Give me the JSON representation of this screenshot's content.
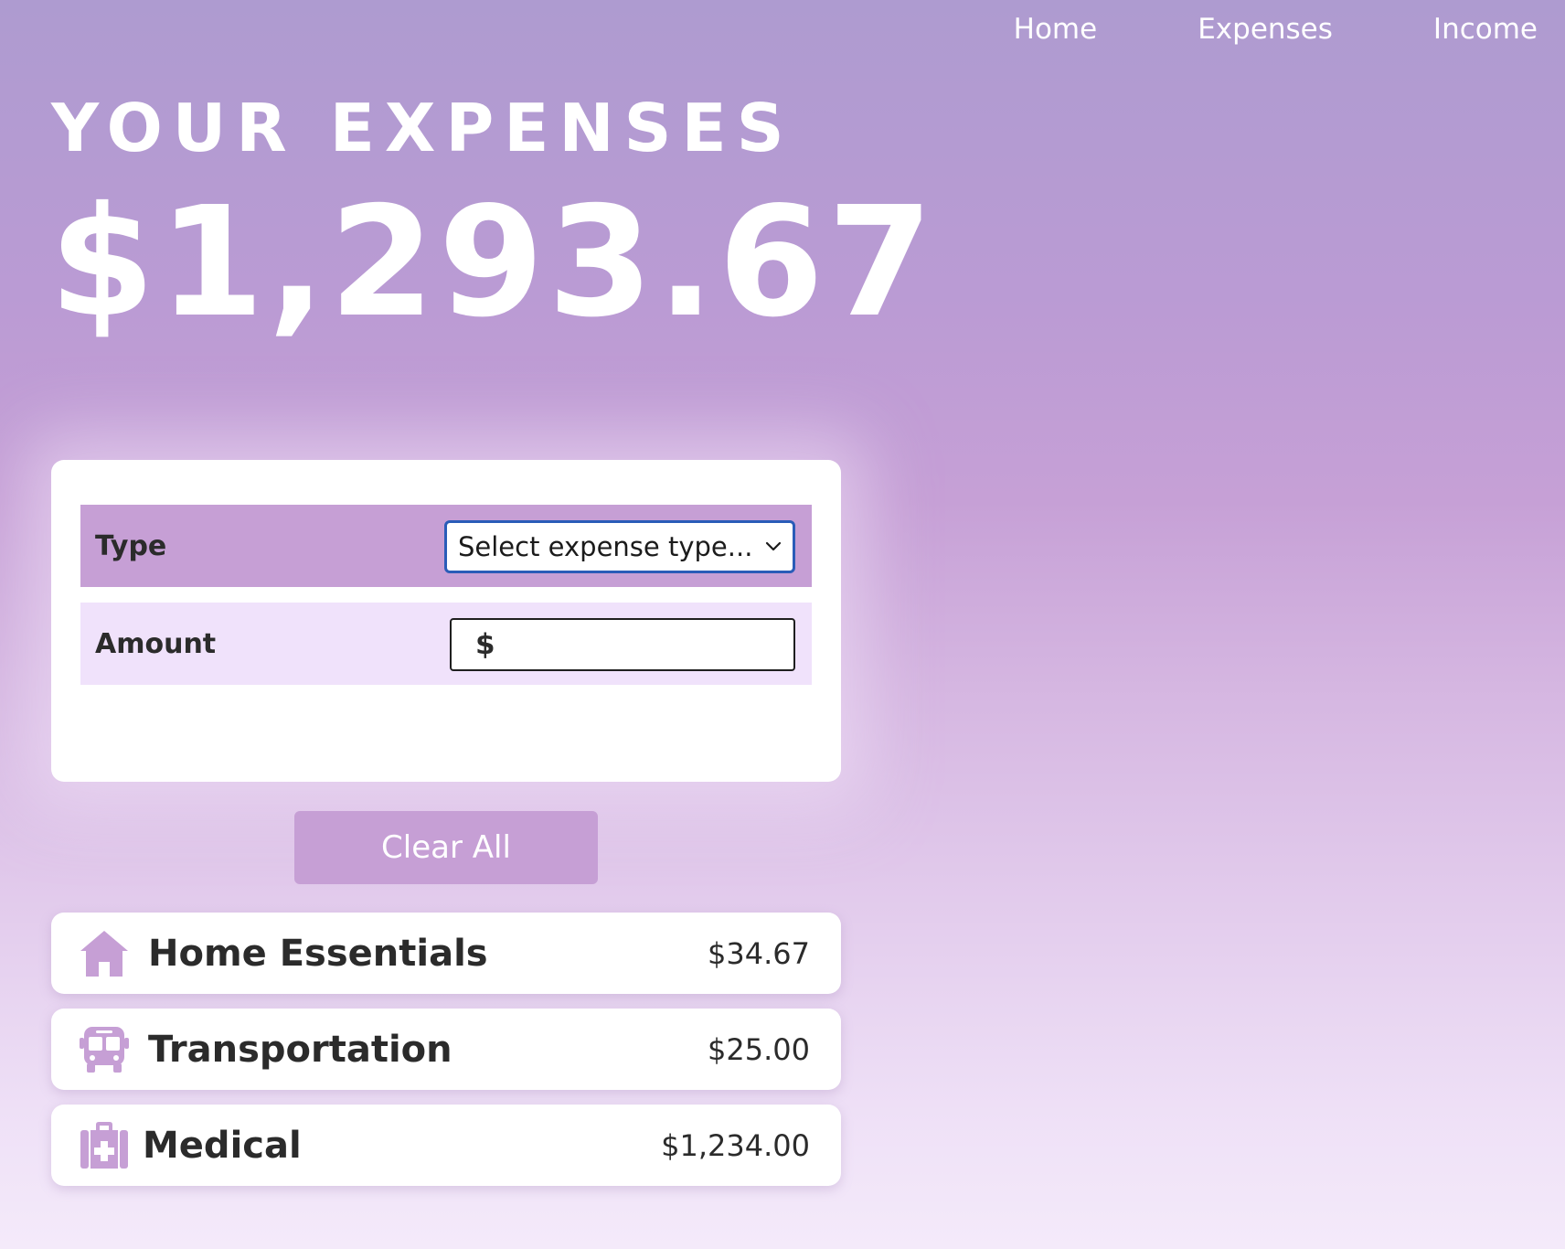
{
  "nav": {
    "links": [
      {
        "label": "Home"
      },
      {
        "label": "Expenses"
      },
      {
        "label": "Income"
      }
    ]
  },
  "header": {
    "title": "YOUR EXPENSES",
    "total": "$1,293.67"
  },
  "form": {
    "type_label": "Type",
    "type_select_value": "Select expense type...",
    "amount_label": "Amount",
    "amount_prefix": "$",
    "amount_value": ""
  },
  "clear_button": {
    "label": "Clear All"
  },
  "expenses": [
    {
      "name": "Home Essentials",
      "amount": "$34.67",
      "icon": "home-icon"
    },
    {
      "name": "Transportation",
      "amount": "$25.00",
      "icon": "bus-icon"
    },
    {
      "name": "Medical",
      "amount": "$1,234.00",
      "icon": "medical-kit-icon"
    }
  ],
  "colors": {
    "accent": "#c69fd5",
    "accent_light": "#f0e2fb",
    "select_focus": "#2a5cb8",
    "text_dark": "#2b2b2b"
  }
}
